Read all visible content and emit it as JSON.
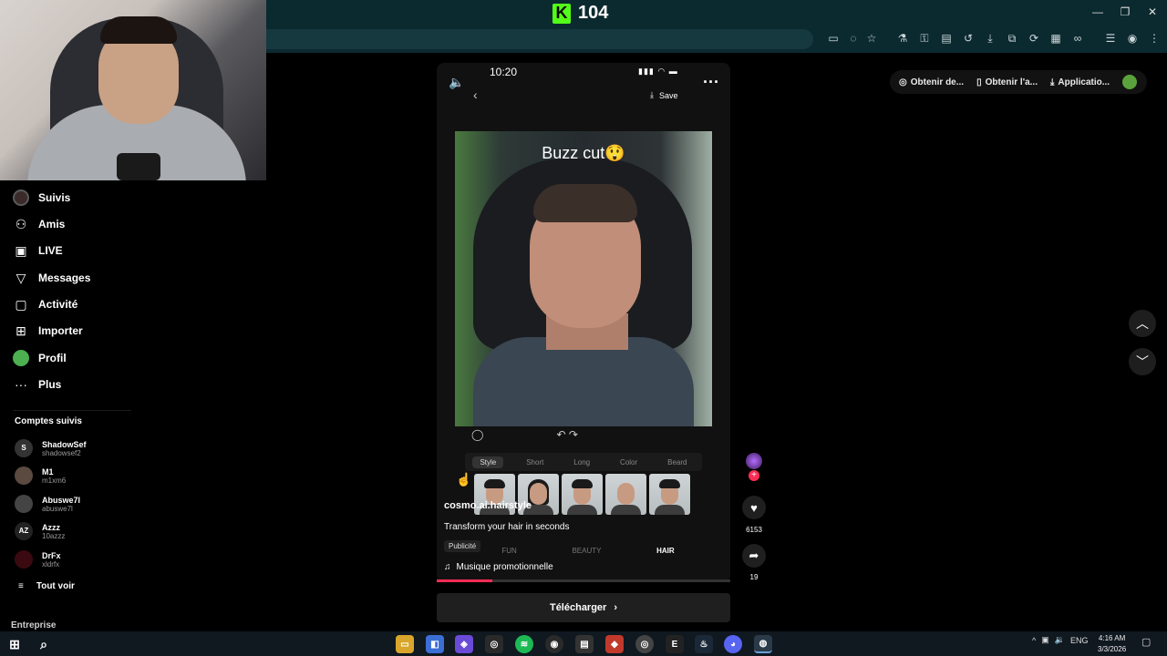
{
  "window": {
    "app_number": "104",
    "minimize": "—",
    "restore": "❐",
    "close": "✕"
  },
  "sidebar": {
    "items": [
      {
        "label": "Suivis",
        "icon": "following-avatar-icon"
      },
      {
        "label": "Amis",
        "icon": "friends-icon"
      },
      {
        "label": "LIVE",
        "icon": "live-icon"
      },
      {
        "label": "Messages",
        "icon": "messages-icon"
      },
      {
        "label": "Activité",
        "icon": "activity-icon"
      },
      {
        "label": "Importer",
        "icon": "upload-icon"
      },
      {
        "label": "Profil",
        "icon": "profile-avatar-icon"
      },
      {
        "label": "Plus",
        "icon": "more-icon"
      }
    ],
    "followed_title": "Comptes suivis",
    "accounts": [
      {
        "name": "ShadowSef",
        "handle": "shadowsef2",
        "av": "S"
      },
      {
        "name": "M1",
        "handle": "m1xm6",
        "av": ""
      },
      {
        "name": "Abuswe7l",
        "handle": "abuswe7l",
        "av": ""
      },
      {
        "name": "Azzz",
        "handle": "10azzz",
        "av": "AZ"
      },
      {
        "name": "DrFx",
        "handle": "xldrfx",
        "av": ""
      }
    ],
    "see_all": "Tout voir",
    "company": "Entreprise"
  },
  "video": {
    "time": "10:20",
    "status_icons": "▮▮▮ ◠ ▬",
    "save_label": "Save",
    "caption": "Buzz cut😲",
    "style_tabs": [
      "Style",
      "Short",
      "Long",
      "Color",
      "Beard"
    ],
    "username": "cosmo.ai.hairstyle",
    "description": "Transform your hair in seconds",
    "ad_badge": "Publicité",
    "mode_tabs": [
      "FUN",
      "BEAUTY",
      "HAIR"
    ],
    "music": "Musique promotionnelle",
    "progress": 0.19,
    "download_label": "Télécharger"
  },
  "actions": {
    "likes": "6153",
    "shares": "19",
    "follow_plus": "+"
  },
  "get_bar": {
    "item1": "Obtenir de...",
    "item2": "Obtenir l'a...",
    "item3": "Applicatio..."
  },
  "taskbar": {
    "lang": "ENG",
    "time": "4:16 AM",
    "date": "3/3/2026"
  },
  "colors": {
    "kick_green": "#53fc18",
    "tiktok_red": "#fe2c55",
    "titlebar": "#0b2a2f"
  }
}
